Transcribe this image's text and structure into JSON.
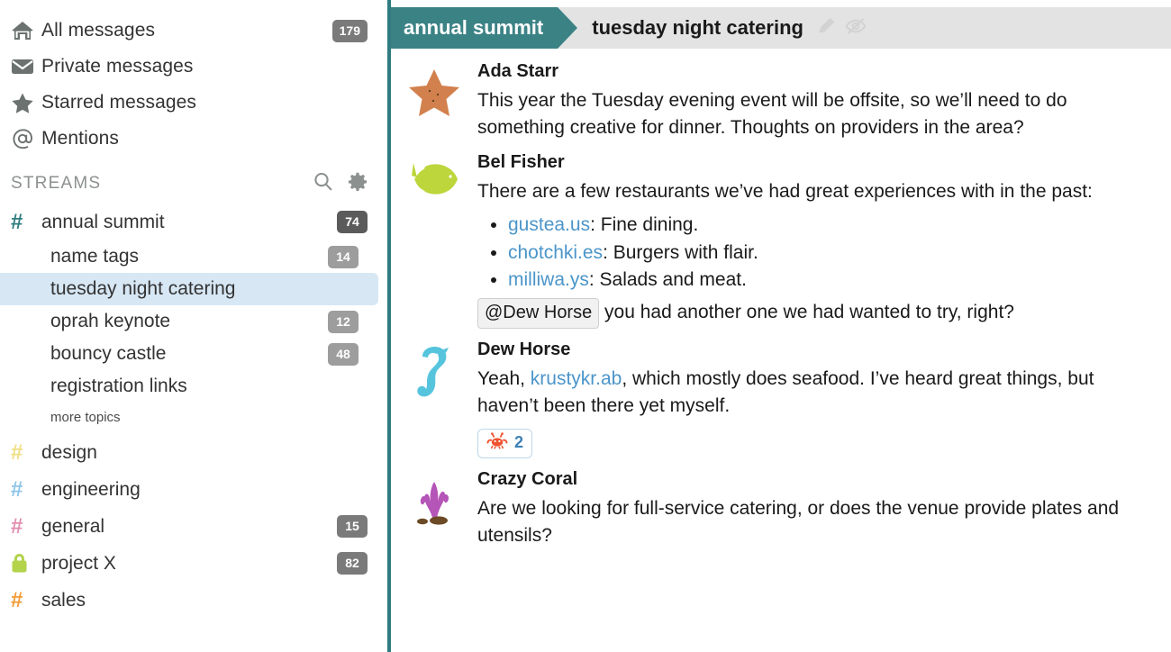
{
  "sidebar": {
    "nav": [
      {
        "icon": "home-icon",
        "label": "All messages",
        "badge": "179"
      },
      {
        "icon": "envelope-icon",
        "label": "Private messages",
        "badge": ""
      },
      {
        "icon": "star-icon",
        "label": "Starred messages",
        "badge": ""
      },
      {
        "icon": "at-icon",
        "label": "Mentions",
        "badge": ""
      }
    ],
    "streams_header": {
      "title": "STREAMS",
      "search_icon": "search-icon",
      "gear_icon": "gear-icon"
    },
    "streams": [
      {
        "name": "annual summit",
        "badge": "74",
        "color": "#2f7c80",
        "icon": "hash-icon"
      },
      {
        "name": "design",
        "badge": "",
        "color": "#f0df86",
        "icon": "hash-icon"
      },
      {
        "name": "engineering",
        "badge": "",
        "color": "#8ec5e8",
        "icon": "hash-icon"
      },
      {
        "name": "general",
        "badge": "15",
        "color": "#e18fb0",
        "icon": "hash-icon"
      },
      {
        "name": "project X",
        "badge": "82",
        "color": "#b2d34a",
        "icon": "lock-icon"
      },
      {
        "name": "sales",
        "badge": "",
        "color": "#f29c38",
        "icon": "hash-icon"
      }
    ],
    "topics": [
      {
        "name": "name tags",
        "badge": "14",
        "selected": false
      },
      {
        "name": "tuesday night catering",
        "badge": "",
        "selected": true
      },
      {
        "name": "oprah keynote",
        "badge": "12",
        "selected": false
      },
      {
        "name": "bouncy castle",
        "badge": "48",
        "selected": false
      },
      {
        "name": "registration links",
        "badge": "",
        "selected": false
      }
    ],
    "more_topics": "more topics"
  },
  "topic_bar": {
    "stream": "annual summit",
    "topic": "tuesday night catering",
    "edit_icon": "pencil-icon",
    "mute_icon": "eye-slash-icon"
  },
  "messages": [
    {
      "sender": "Ada Starr",
      "avatar": "starfish-icon",
      "text": "This year the Tuesday evening event will be offsite, so we’ll need to do something creative for dinner. Thoughts on providers in the area?"
    },
    {
      "sender": "Bel Fisher",
      "avatar": "fish-icon",
      "text": "There are a few restaurants we’ve had great experiences with in the past:",
      "bullets": [
        {
          "link": "gustea.us",
          "rest": ": Fine dining."
        },
        {
          "link": "chotchki.es",
          "rest": ": Burgers with flair."
        },
        {
          "link": "milliwa.ys",
          "rest": ": Salads and meat."
        }
      ],
      "mention": "@Dew Horse",
      "after_mention": " you had another one we had wanted to try, right?"
    },
    {
      "sender": "Dew Horse",
      "avatar": "seahorse-icon",
      "text_before": "Yeah, ",
      "link": "krustykr.ab",
      "text_after": ", which mostly does seafood. I’ve heard great things, but haven’t been there yet myself.",
      "reaction": {
        "emoji": "crab-icon",
        "count": "2"
      }
    },
    {
      "sender": "Crazy Coral",
      "avatar": "coral-icon",
      "text": "Are we looking for full-service catering, or does the venue provide plates and utensils?"
    }
  ],
  "colors": {
    "accent_teal": "#2f7c80",
    "tag_teal": "#3b8285",
    "link_blue": "#4b95c9",
    "selected_topic": "#d7e7f4",
    "topic_bar_bg": "#e3e3e3"
  }
}
